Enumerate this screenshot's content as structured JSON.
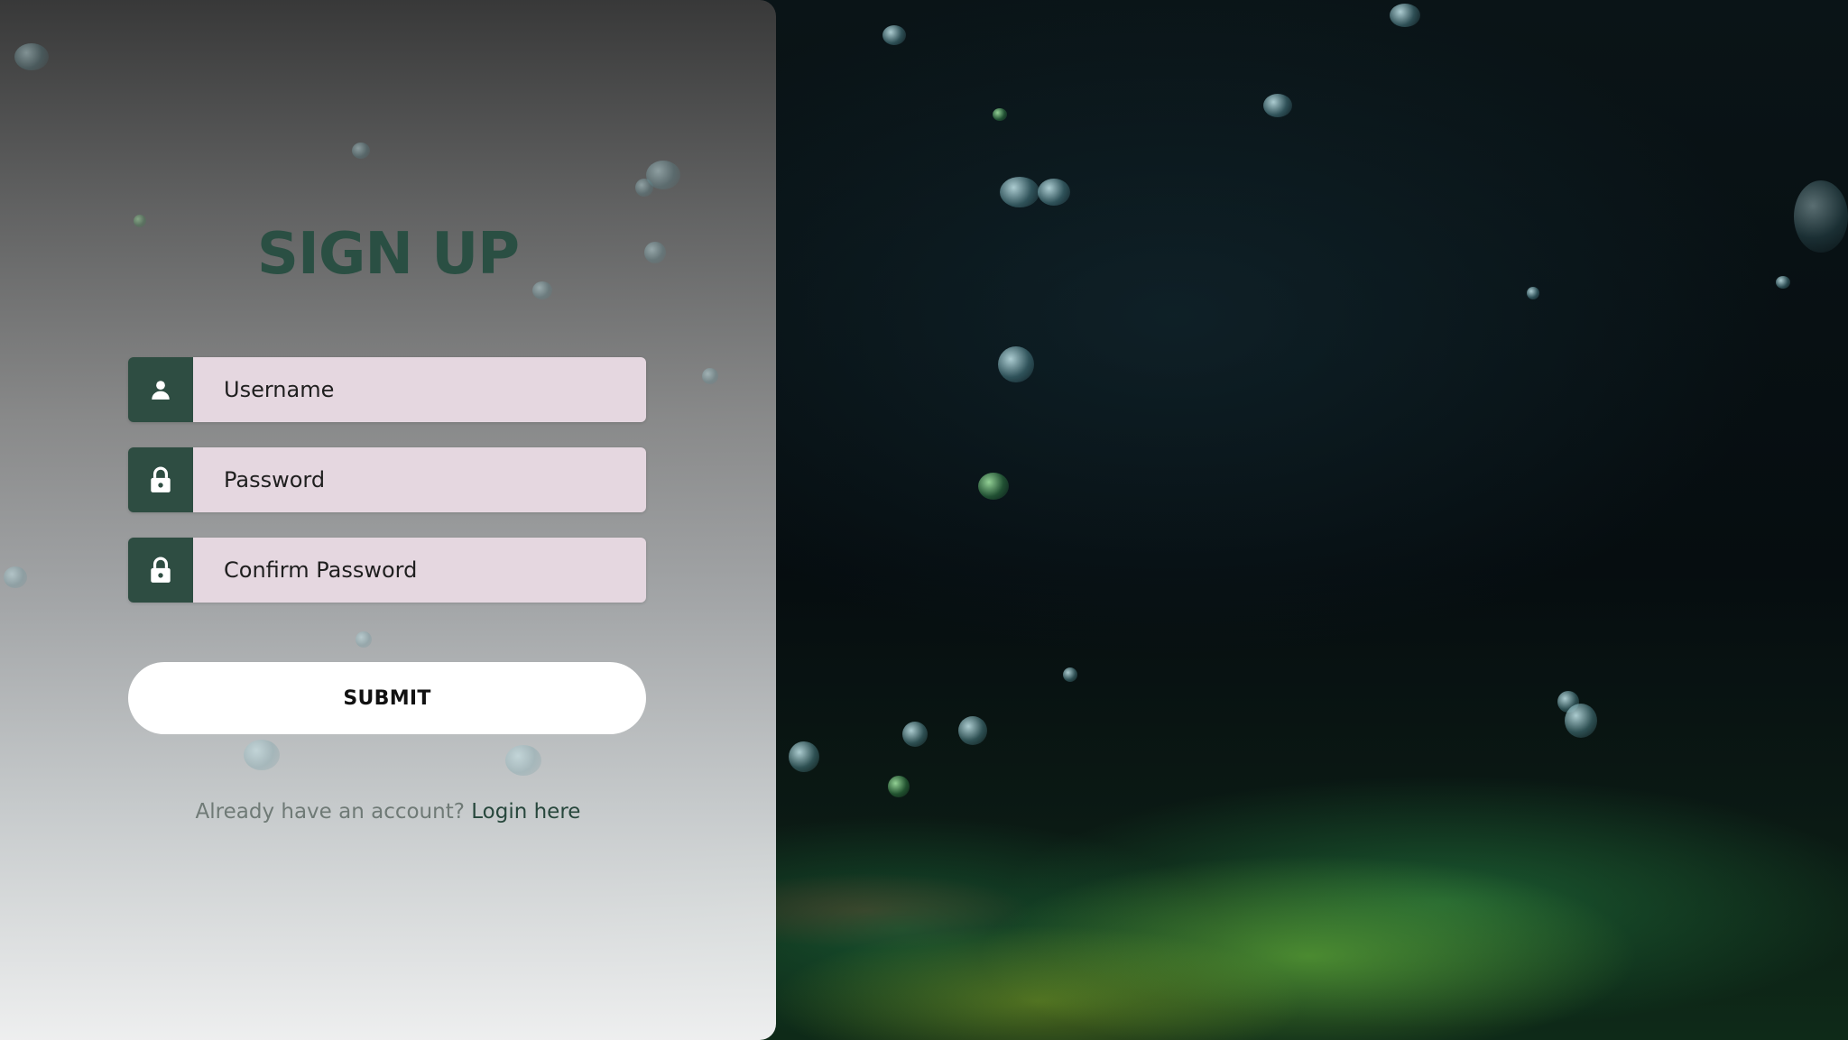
{
  "signup": {
    "title": "SIGN UP",
    "fields": [
      {
        "icon": "user-icon",
        "placeholder": "Username"
      },
      {
        "icon": "lock-icon",
        "placeholder": "Password"
      },
      {
        "icon": "lock-icon",
        "placeholder": "Confirm Password"
      }
    ],
    "submit_label": "SUBMIT",
    "login_prompt": "Already have an account?",
    "login_link": "Login here"
  },
  "colors": {
    "accent": "#2e4d42",
    "title": "#2a4f43",
    "input_bg": "#e5d7e0",
    "button_bg": "#ffffff"
  }
}
